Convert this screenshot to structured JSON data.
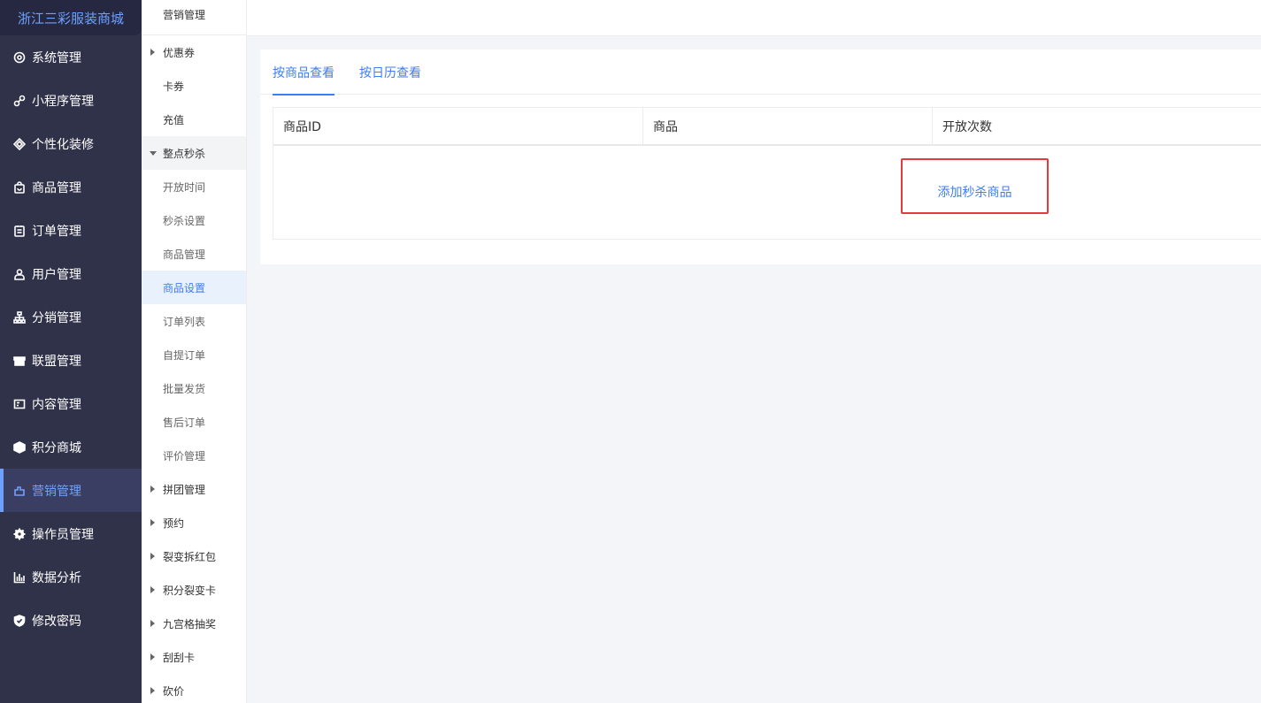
{
  "brand": "浙江三彩服装商城",
  "nav": [
    {
      "label": "系统管理",
      "icon": "settings-icon"
    },
    {
      "label": "小程序管理",
      "icon": "mini-program-icon"
    },
    {
      "label": "个性化装修",
      "icon": "decoration-icon"
    },
    {
      "label": "商品管理",
      "icon": "product-bag-icon"
    },
    {
      "label": "订单管理",
      "icon": "order-icon"
    },
    {
      "label": "用户管理",
      "icon": "user-icon"
    },
    {
      "label": "分销管理",
      "icon": "distribution-icon"
    },
    {
      "label": "联盟管理",
      "icon": "store-icon"
    },
    {
      "label": "内容管理",
      "icon": "content-icon"
    },
    {
      "label": "积分商城",
      "icon": "cube-icon"
    },
    {
      "label": "营销管理",
      "icon": "marketing-icon"
    },
    {
      "label": "操作员管理",
      "icon": "gear-icon"
    },
    {
      "label": "数据分析",
      "icon": "bar-chart-icon"
    },
    {
      "label": "修改密码",
      "icon": "shield-icon"
    }
  ],
  "submenu": {
    "title": "营销管理",
    "items": [
      {
        "label": "优惠券"
      },
      {
        "label": "卡券"
      },
      {
        "label": "充值"
      },
      {
        "label": "整点秒杀"
      },
      {
        "label": "开放时间"
      },
      {
        "label": "秒杀设置"
      },
      {
        "label": "商品管理"
      },
      {
        "label": "商品设置"
      },
      {
        "label": "订单列表"
      },
      {
        "label": "自提订单"
      },
      {
        "label": "批量发货"
      },
      {
        "label": "售后订单"
      },
      {
        "label": "评价管理"
      },
      {
        "label": "拼团管理"
      },
      {
        "label": "预约"
      },
      {
        "label": "裂变拆红包"
      },
      {
        "label": "积分裂变卡"
      },
      {
        "label": "九宫格抽奖"
      },
      {
        "label": "刮刮卡"
      },
      {
        "label": "砍价"
      }
    ]
  },
  "tabs": [
    "按商品查看",
    "按日历查看"
  ],
  "table": {
    "columns": [
      "商品ID",
      "商品",
      "开放次数"
    ]
  },
  "add_link": "添加秒杀商品",
  "colors": {
    "accent": "#3f7ef0",
    "highlight_border": "#e33b3b",
    "sidebar_bg": "#2f3249"
  }
}
